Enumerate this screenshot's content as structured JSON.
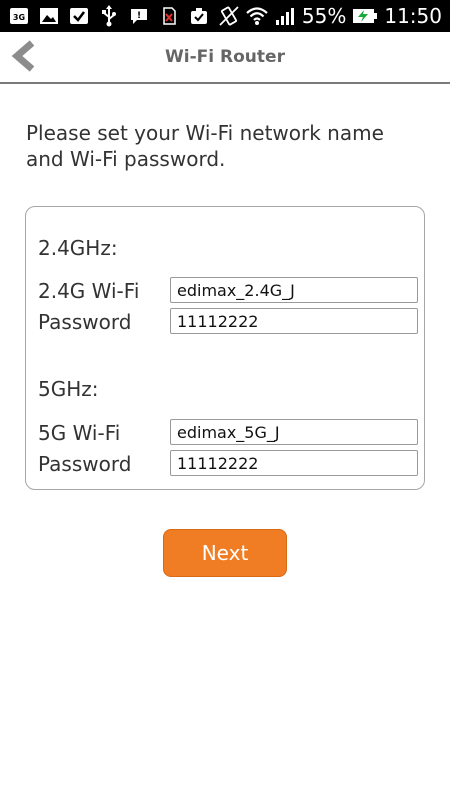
{
  "status_bar": {
    "battery_percent": "55%",
    "time": "11:50",
    "left_icons": [
      "3g-data-icon",
      "image-icon",
      "checkbox-icon",
      "usb-icon",
      "message-icon",
      "no-sim-icon",
      "clipboard-check-icon"
    ],
    "right_icons": [
      "vibrate-icon",
      "wifi-icon",
      "signal-icon",
      "battery-charging-icon"
    ]
  },
  "header": {
    "title": "Wi-Fi Router",
    "back_icon": "chevron-left-icon"
  },
  "instructions": "Please set your Wi-Fi network name and Wi-Fi password.",
  "band_24": {
    "heading": "2.4GHz:",
    "ssid_label": "2.4G Wi-Fi",
    "ssid_value": "edimax_2.4G_J",
    "password_label": "Password",
    "password_value": "11112222"
  },
  "band_5": {
    "heading": "5GHz:",
    "ssid_label": "5G Wi-Fi",
    "ssid_value": "edimax_5G_J",
    "password_label": "Password",
    "password_value": "11112222"
  },
  "next_button": {
    "label": "Next",
    "color": "#f07d24"
  }
}
